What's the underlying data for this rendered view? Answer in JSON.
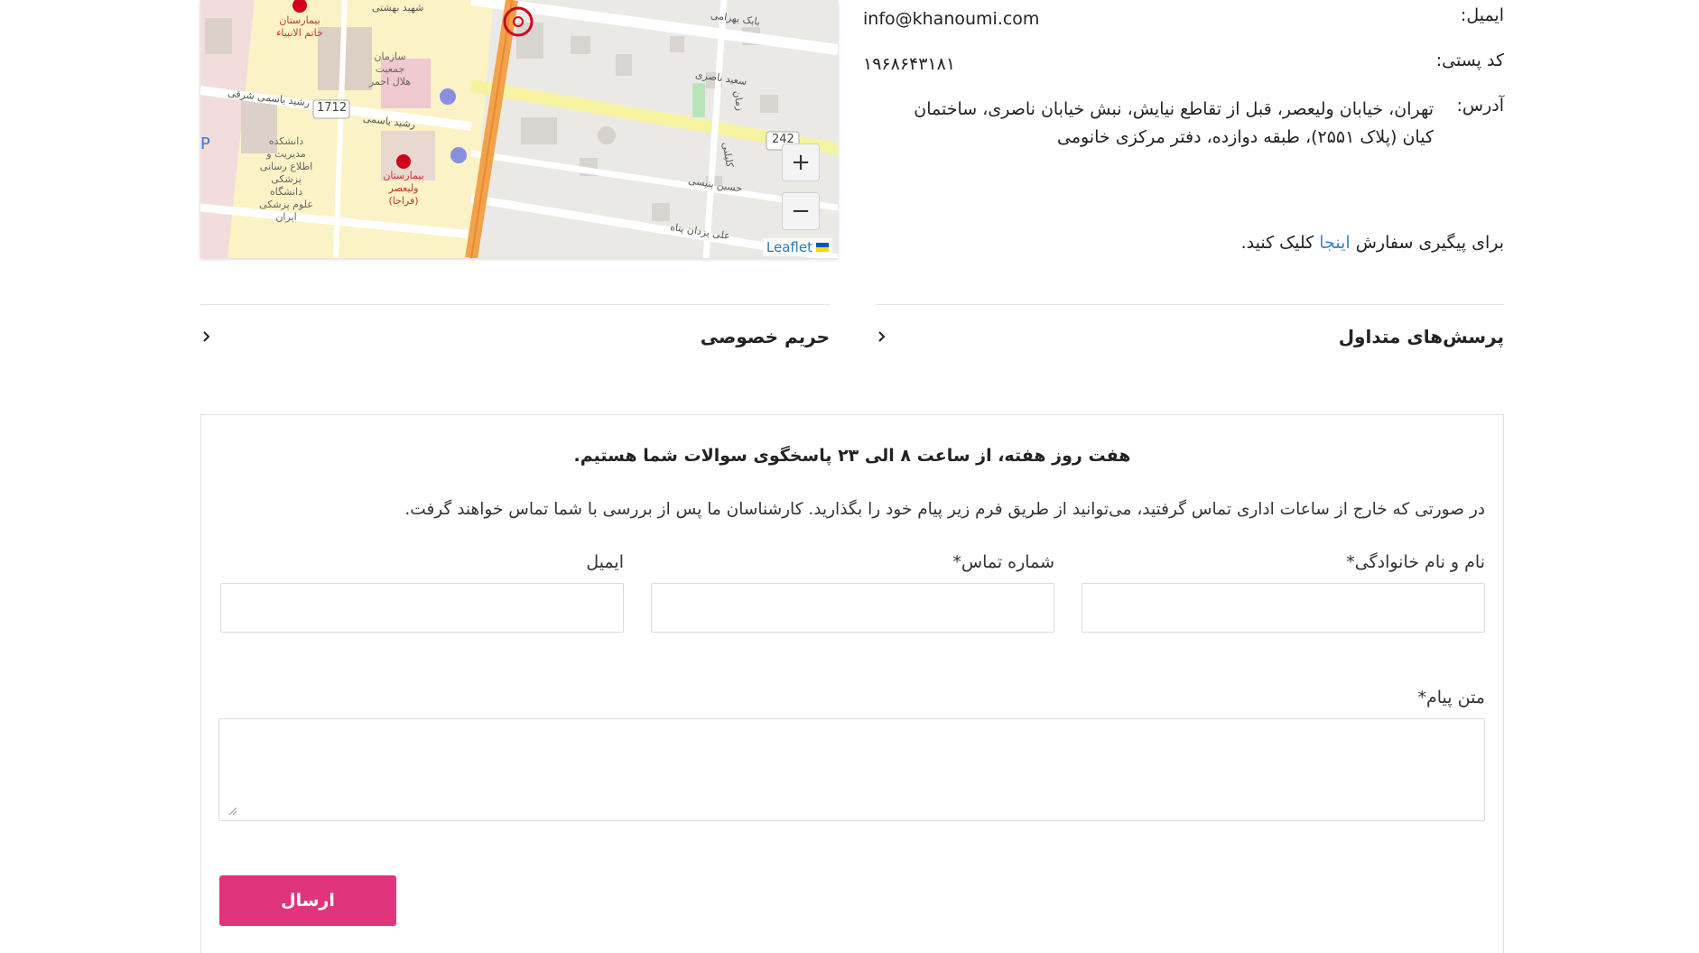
{
  "map": {
    "zoom_in": "+",
    "zoom_out": "−",
    "attribution": "Leaflet",
    "streets": [
      "شهید بهشتی",
      "بابک بهرامی",
      "سعید ناصری",
      "رشید یاسمی شرقی",
      "رشید یاسمی",
      "حسین بنیسی",
      "علی یزدان پناه",
      "کلیلنی",
      "زمان"
    ],
    "places": [
      "بیمارستان خاتم الانبیاء",
      "سازمان جمعیت هلال احمر",
      "دانشکده مدیریت و اطلاع رسانی پزشکی دانشگاه علوم پزشکی ایران",
      "بیمارستان ولیعصر (فراجا)"
    ],
    "badges": [
      "1712",
      "242"
    ]
  },
  "contact": {
    "email_label": "ایمیل:",
    "email_value": "info@khanoumi.com",
    "postal_label": "کد پستی:",
    "postal_value": "۱۹۶۸۶۴۳۱۸۱",
    "address_label": "آدرس:",
    "address_value": "تهران، خیابان ولیعصر، قبل از تقاطع نیایش، نبش خیابان ناصری، ساختمان کیان (پلاک ۲۵۵۱)، طبقه دوازده، دفتر مرکزی خانومی",
    "track_prefix": "برای پیگیری سفارش",
    "track_link": "اینجا",
    "track_suffix": "کلیک کنید."
  },
  "accordions": {
    "faq": "پرسش‌های متداول",
    "privacy": "حریم خصوصی"
  },
  "form": {
    "headline": "هفت روز هفته، از ساعت ۸ الی ۲۳ پاسخگوی سوالات شما هستیم.",
    "description": "در صورتی که خارج از ساعات اداری تماس گرفتید، می‌توانید از طریق فرم زیر پیام خود را بگذارید. کارشناسان ما پس از بررسی با شما تماس خواهند گرفت.",
    "name_label": "نام و نام خانوادگی*",
    "phone_label": "شماره تماس*",
    "email_label": "ایمیل",
    "message_label": "متن پیام*",
    "submit_label": "ارسال"
  }
}
